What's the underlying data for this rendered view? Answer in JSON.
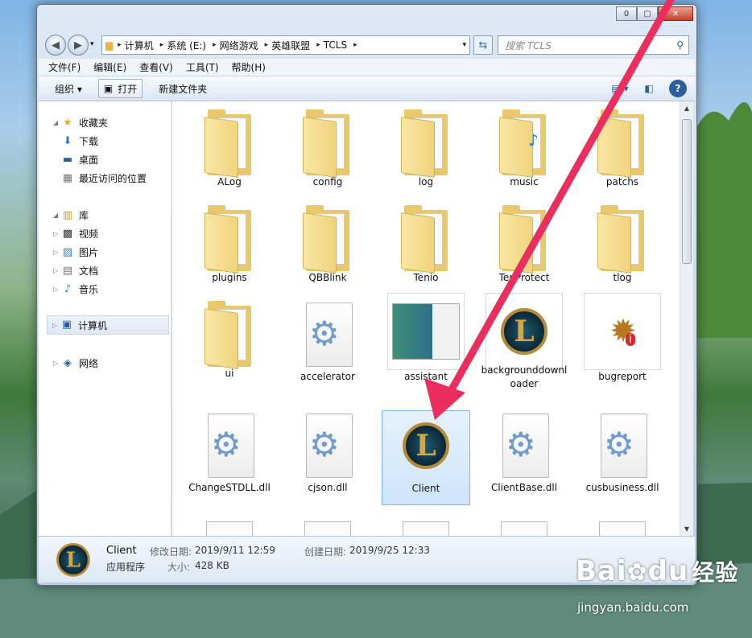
{
  "window": {
    "caption": {
      "min": "0",
      "max": "▢",
      "close": "✕"
    }
  },
  "nav": {
    "back": "◀",
    "forward": "▶",
    "recent": "▾"
  },
  "address": {
    "crumbs": [
      "计算机",
      "系统 (E:)",
      "网络游戏",
      "英雄联盟",
      "TCLS"
    ],
    "separator": "▸",
    "dropdown": "▾"
  },
  "search": {
    "placeholder": "搜索 TCLS",
    "icon": "⚲"
  },
  "menu": [
    "文件(F)",
    "编辑(E)",
    "查看(V)",
    "工具(T)",
    "帮助(H)"
  ],
  "toolbar": {
    "organize": "组织 ▾",
    "open": "打开",
    "newfolder": "新建文件夹"
  },
  "sidebar": {
    "favorites": "收藏夹",
    "fav_items": [
      "下载",
      "桌面",
      "最近访问的位置"
    ],
    "libraries": "库",
    "lib_items": [
      "视频",
      "图片",
      "文档",
      "音乐"
    ],
    "computer": "计算机",
    "network": "网络"
  },
  "files": [
    {
      "name": "ALog",
      "kind": "folder"
    },
    {
      "name": "config",
      "kind": "folder"
    },
    {
      "name": "log",
      "kind": "folder"
    },
    {
      "name": "music",
      "kind": "folder-mp3"
    },
    {
      "name": "patchs",
      "kind": "folder"
    },
    {
      "name": "plugins",
      "kind": "folder"
    },
    {
      "name": "QBBlink",
      "kind": "folder"
    },
    {
      "name": "Tenio",
      "kind": "folder"
    },
    {
      "name": "TenProtect",
      "kind": "folder"
    },
    {
      "name": "tlog",
      "kind": "folder"
    },
    {
      "name": "ui",
      "kind": "folder"
    },
    {
      "name": "accelerator",
      "kind": "dll"
    },
    {
      "name": "assistant",
      "kind": "thumb"
    },
    {
      "name": "backgrounddownloader",
      "kind": "lol"
    },
    {
      "name": "bugreport",
      "kind": "bug"
    },
    {
      "name": "ChangeSTDLL.dll",
      "kind": "dll"
    },
    {
      "name": "cjson.dll",
      "kind": "dll"
    },
    {
      "name": "Client",
      "kind": "lol",
      "selected": true
    },
    {
      "name": "ClientBase.dll",
      "kind": "dll"
    },
    {
      "name": "cusbusiness.dll",
      "kind": "dll"
    }
  ],
  "status": {
    "name": "Client",
    "type": "应用程序",
    "modified_label": "修改日期:",
    "modified": "2019/9/11 12:59",
    "created_label": "创建日期:",
    "created": "2019/9/25 12:33",
    "size_label": "大小:",
    "size": "428 KB"
  },
  "watermark": {
    "brand": "Bai",
    "paw": "du",
    "cn": "经验",
    "url": "jingyan.baidu.com"
  },
  "colors": {
    "arrow": "#ec2e5f",
    "selection": "#cfe5fb",
    "folder": "#e8c86a"
  }
}
